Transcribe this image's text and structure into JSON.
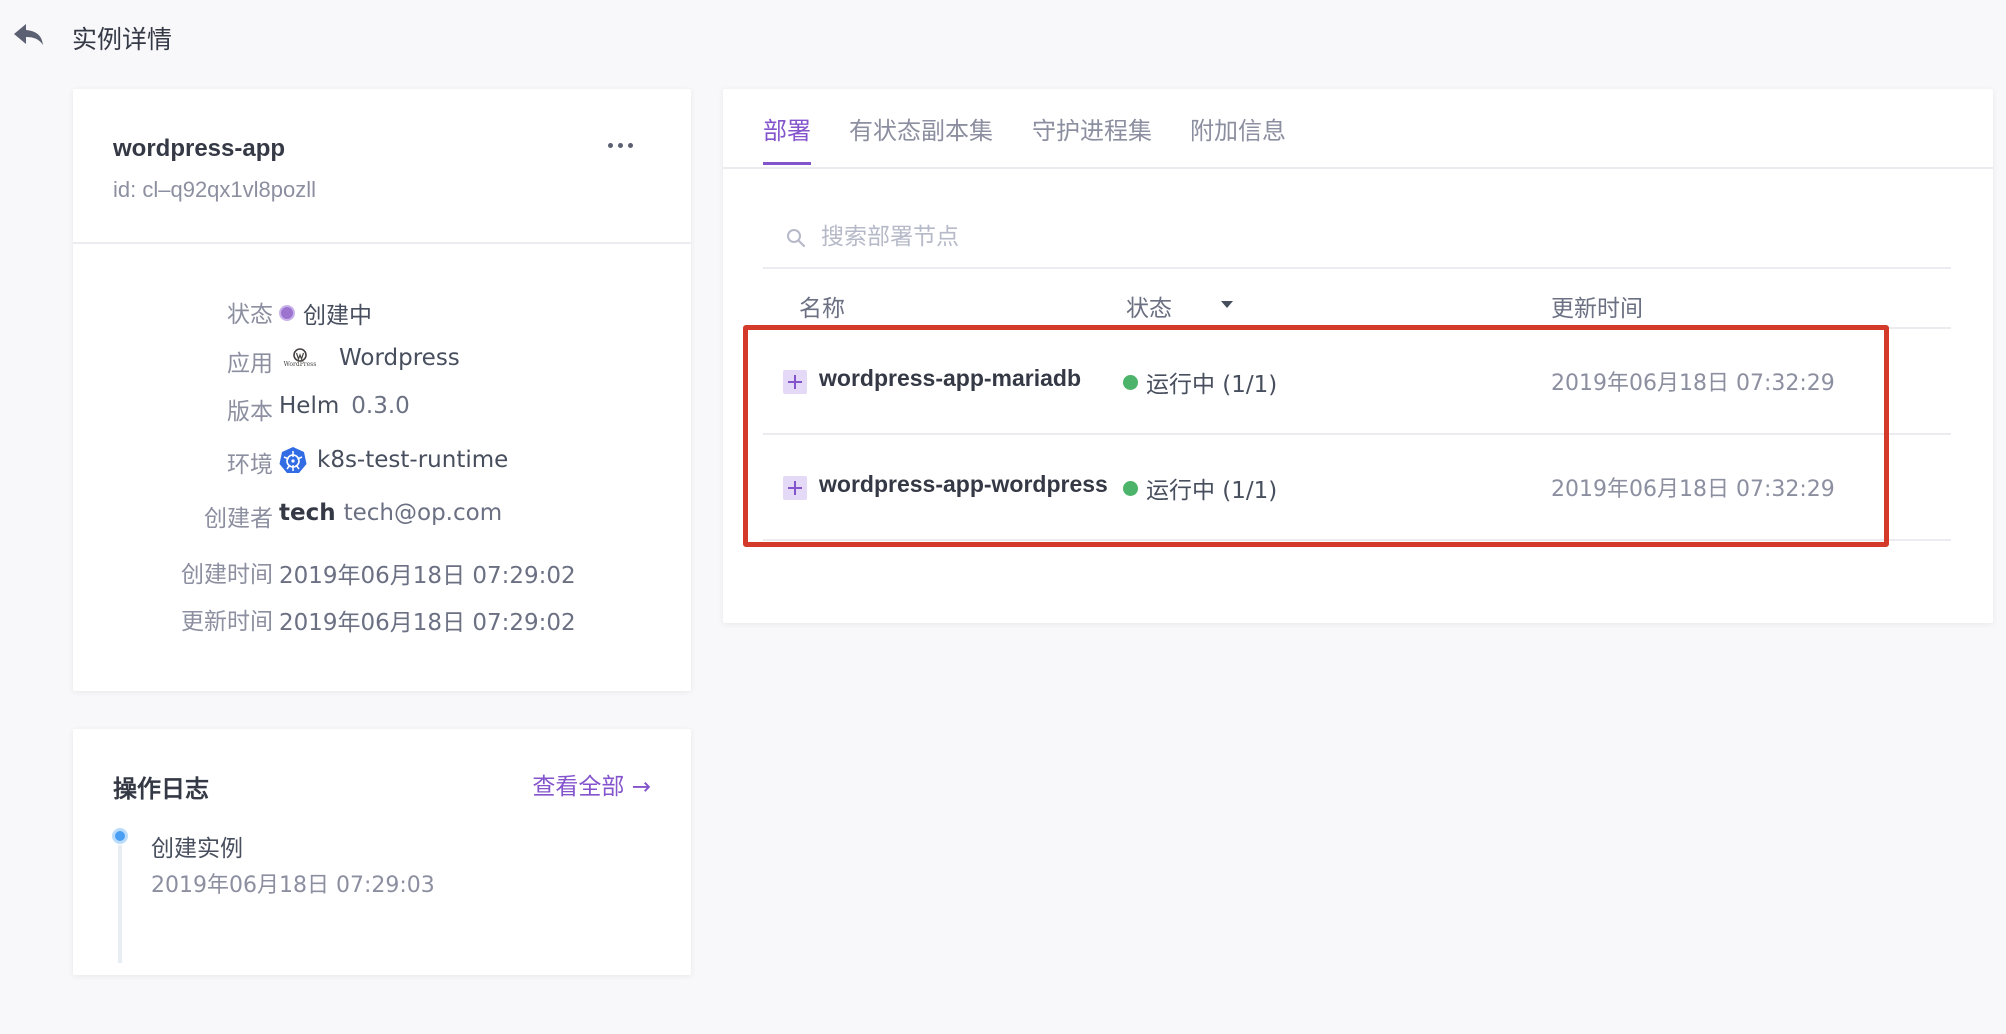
{
  "header": {
    "title": "实例详情"
  },
  "instance": {
    "name": "wordpress-app",
    "id": "id: cl–q92qx1vl8pozll",
    "fields": {
      "status_label": "状态",
      "status_value": "创建中",
      "app_label": "应用",
      "app_value": "Wordpress",
      "app_logo_text": "WordPress",
      "version_label": "版本",
      "version_type": "Helm",
      "version_value": "0.3.0",
      "env_label": "环境",
      "env_value": "k8s-test-runtime",
      "creator_label": "创建者",
      "creator_name": "tech",
      "creator_email": "tech@op.com",
      "created_label": "创建时间",
      "created_value": "2019年06月18日 07:29:02",
      "updated_label": "更新时间",
      "updated_value": "2019年06月18日 07:29:02"
    }
  },
  "log": {
    "title": "操作日志",
    "view_all": "查看全部 →",
    "entries": [
      {
        "event": "创建实例",
        "time": "2019年06月18日 07:29:03"
      }
    ]
  },
  "tabs": [
    "部署",
    "有状态副本集",
    "守护进程集",
    "附加信息"
  ],
  "search": {
    "placeholder": "搜索部署节点"
  },
  "table": {
    "columns": [
      "名称",
      "状态",
      "更新时间"
    ],
    "rows": [
      {
        "name": "wordpress-app-mariadb",
        "status": "运行中 (1/1)",
        "updated": "2019年06月18日 07:32:29"
      },
      {
        "name": "wordpress-app-wordpress",
        "status": "运行中 (1/1)",
        "updated": "2019年06月18日 07:32:29"
      }
    ]
  },
  "colors": {
    "accent": "#8454cd",
    "status_creating": "#9c74d0",
    "status_running": "#4cb36a",
    "highlight": "#d43a2a"
  }
}
